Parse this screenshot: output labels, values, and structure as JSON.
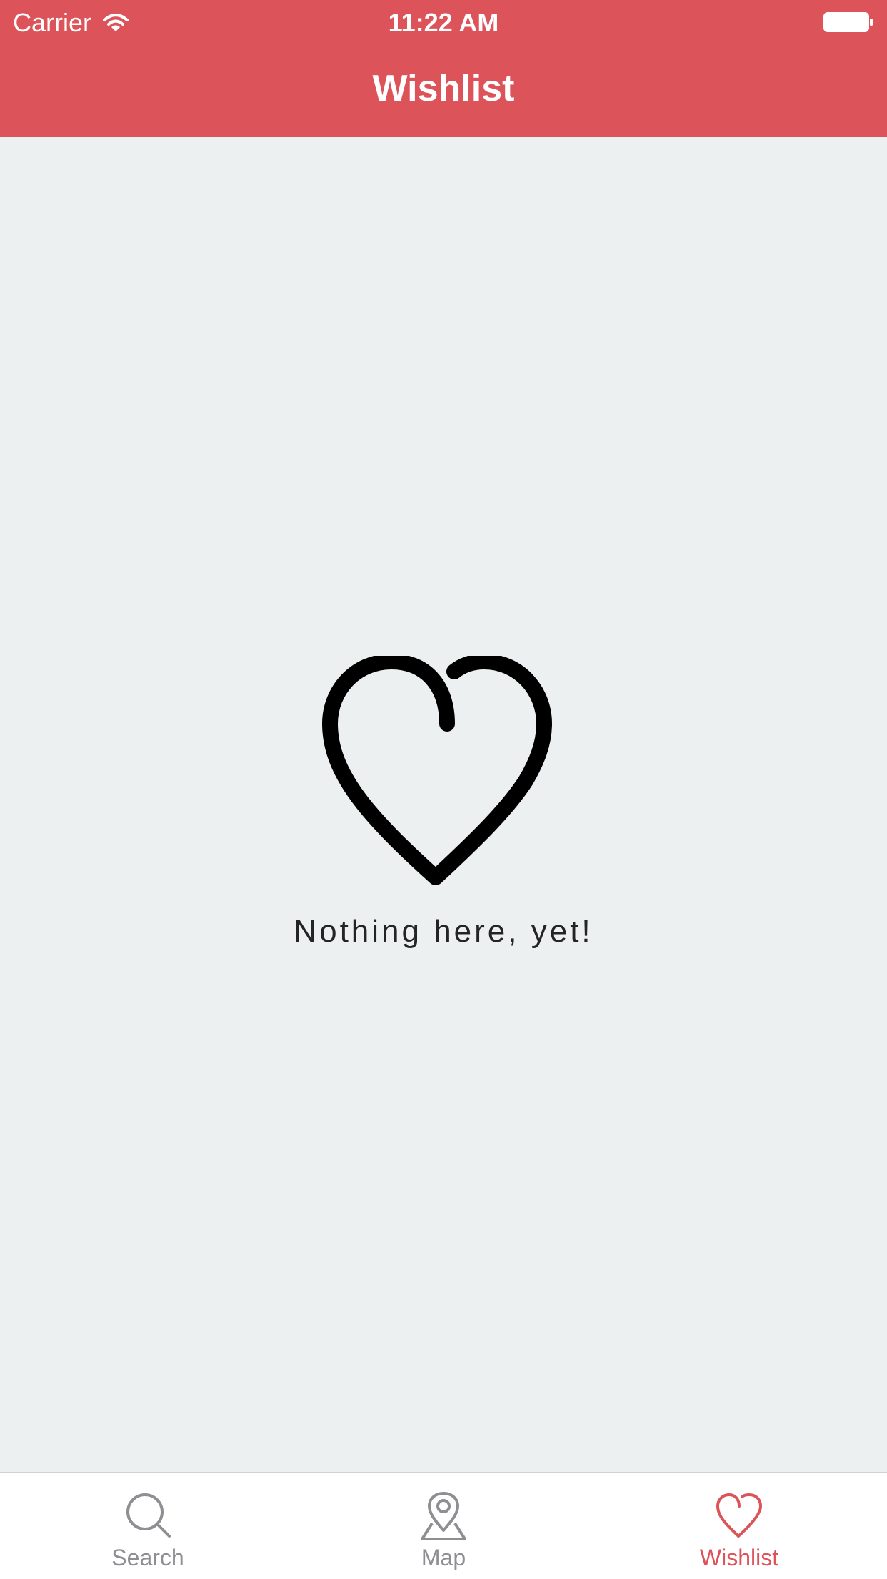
{
  "status_bar": {
    "carrier": "Carrier",
    "time": "11:22 AM",
    "icons": [
      "wifi-icon",
      "battery-icon"
    ]
  },
  "nav": {
    "title": "Wishlist"
  },
  "empty_state": {
    "icon": "heart-outline-icon",
    "message": "Nothing here, yet!"
  },
  "tab_bar": {
    "tabs": [
      {
        "label": "Search",
        "icon": "search-icon",
        "active": false
      },
      {
        "label": "Map",
        "icon": "map-pin-icon",
        "active": false
      },
      {
        "label": "Wishlist",
        "icon": "heart-icon",
        "active": true
      }
    ]
  },
  "colors": {
    "brand": "#dc545a",
    "background": "#edf0f1",
    "inactive_tab": "#8e8e93"
  }
}
